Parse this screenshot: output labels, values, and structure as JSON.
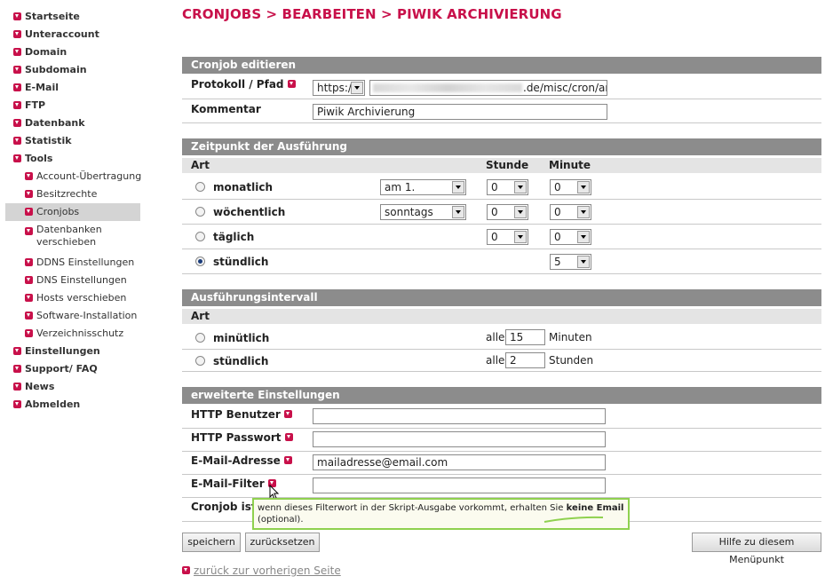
{
  "sidebar": {
    "items": [
      {
        "label": "Startseite"
      },
      {
        "label": "Unteraccount"
      },
      {
        "label": "Domain"
      },
      {
        "label": "Subdomain"
      },
      {
        "label": "E-Mail"
      },
      {
        "label": "FTP"
      },
      {
        "label": "Datenbank"
      },
      {
        "label": "Statistik"
      },
      {
        "label": "Tools"
      }
    ],
    "tools_sub": [
      {
        "label": "Account-Übertragung"
      },
      {
        "label": "Besitzrechte"
      },
      {
        "label": "Cronjobs"
      },
      {
        "label": "Datenbanken verschieben"
      },
      {
        "label": "DDNS Einstellungen"
      },
      {
        "label": "DNS Einstellungen"
      },
      {
        "label": "Hosts verschieben"
      },
      {
        "label": "Software-Installation"
      },
      {
        "label": "Verzeichnisschutz"
      }
    ],
    "items_after": [
      {
        "label": "Einstellungen"
      },
      {
        "label": "Support/ FAQ"
      },
      {
        "label": "News"
      },
      {
        "label": "Abmelden"
      }
    ],
    "active_item": "Cronjobs"
  },
  "title": "CRONJOBS > BEARBEITEN > PIWIK ARCHIVIERUNG",
  "edit": {
    "header": "Cronjob editieren",
    "protocol_label": "Protokoll / Pfad",
    "protocol_value": "https://",
    "path_value": ".de/misc/cron/archiv",
    "comment_label": "Kommentar",
    "comment_value": "Piwik Archivierung"
  },
  "timing": {
    "header": "Zeitpunkt der Ausführung",
    "col_art": "Art",
    "col_stunde": "Stunde",
    "col_minute": "Minute",
    "rows": [
      {
        "label": "monatlich",
        "day": "am 1.",
        "hour": "0",
        "minute": "0"
      },
      {
        "label": "wöchentlich",
        "day": "sonntags",
        "hour": "0",
        "minute": "0"
      },
      {
        "label": "täglich",
        "hour": "0",
        "minute": "0"
      },
      {
        "label": "stündlich",
        "minute": "5"
      }
    ],
    "selected": "stündlich"
  },
  "interval": {
    "header": "Ausführungsintervall",
    "col_art": "Art",
    "rows": [
      {
        "label": "minütlich",
        "prefix": "alle",
        "value": "15",
        "unit": "Minuten"
      },
      {
        "label": "stündlich",
        "prefix": "alle",
        "value": "2",
        "unit": "Stunden"
      }
    ]
  },
  "advanced": {
    "header": "erweiterte Einstellungen",
    "http_user_label": "HTTP Benutzer",
    "http_user_value": "",
    "http_pass_label": "HTTP Passwort",
    "http_pass_value": "",
    "email_label": "E-Mail-Adresse",
    "email_value": "mailadresse@email.com",
    "filter_label": "E-Mail-Filter",
    "filter_value": "",
    "active_label": "Cronjob ist"
  },
  "tooltip": {
    "text_before": "wenn dieses Filterwort in der Skript-Ausgabe vorkommt, erhalten Sie ",
    "text_bold": "keine Email",
    "text_after": "(optional)."
  },
  "buttons": {
    "save": "speichern",
    "reset": "zurücksetzen",
    "help": "Hilfe zu diesem Menüpunkt"
  },
  "back_link": "zurück zur vorherigen Seite",
  "colors": {
    "accent": "#c8104a",
    "header_bg": "#8c8c8c",
    "tooltip_border": "#8fd14f"
  }
}
